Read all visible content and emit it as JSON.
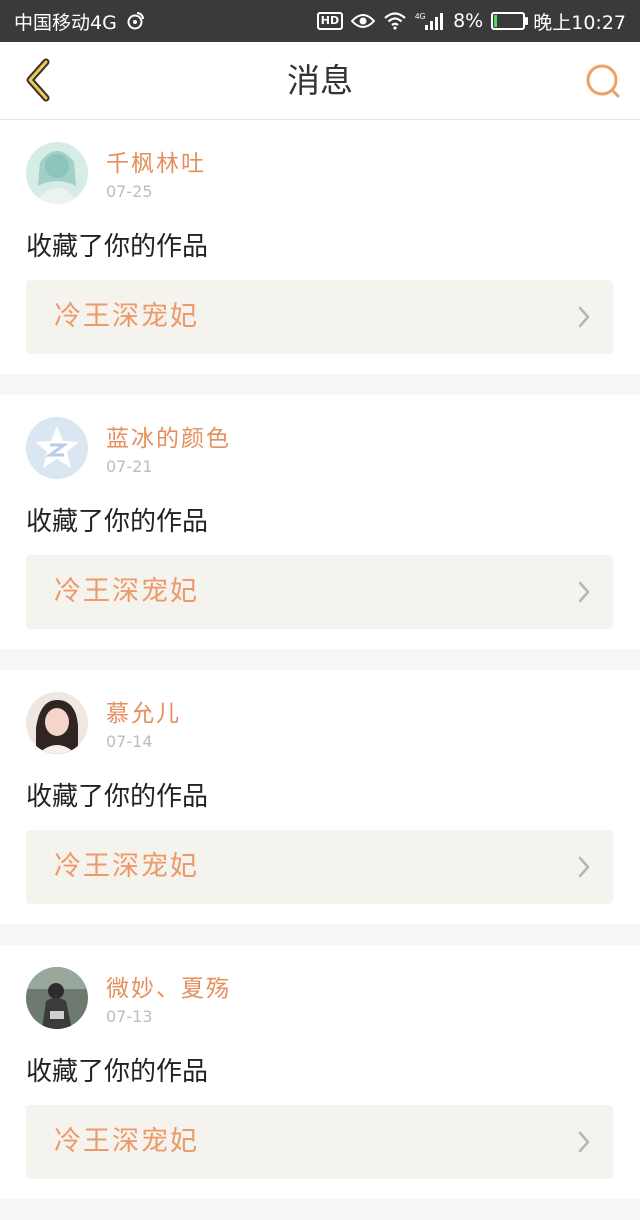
{
  "status_bar": {
    "carrier": "中国移动4G",
    "network": "4G",
    "battery": "8%",
    "battery_level": 0.08,
    "time": "晚上10:27"
  },
  "header": {
    "title": "消息"
  },
  "colors": {
    "accent": "#e58f5e",
    "link_bg": "#f5f3ee"
  },
  "messages": [
    {
      "username": "千枫林吐",
      "date": "07-25",
      "action": "收藏了你的作品",
      "work_title": "冷王深宠妃"
    },
    {
      "username": "蓝冰的颜色",
      "date": "07-21",
      "action": "收藏了你的作品",
      "work_title": "冷王深宠妃"
    },
    {
      "username": "慕允儿",
      "date": "07-14",
      "action": "收藏了你的作品",
      "work_title": "冷王深宠妃"
    },
    {
      "username": "微妙、夏殇",
      "date": "07-13",
      "action": "收藏了你的作品",
      "work_title": "冷王深宠妃"
    }
  ]
}
